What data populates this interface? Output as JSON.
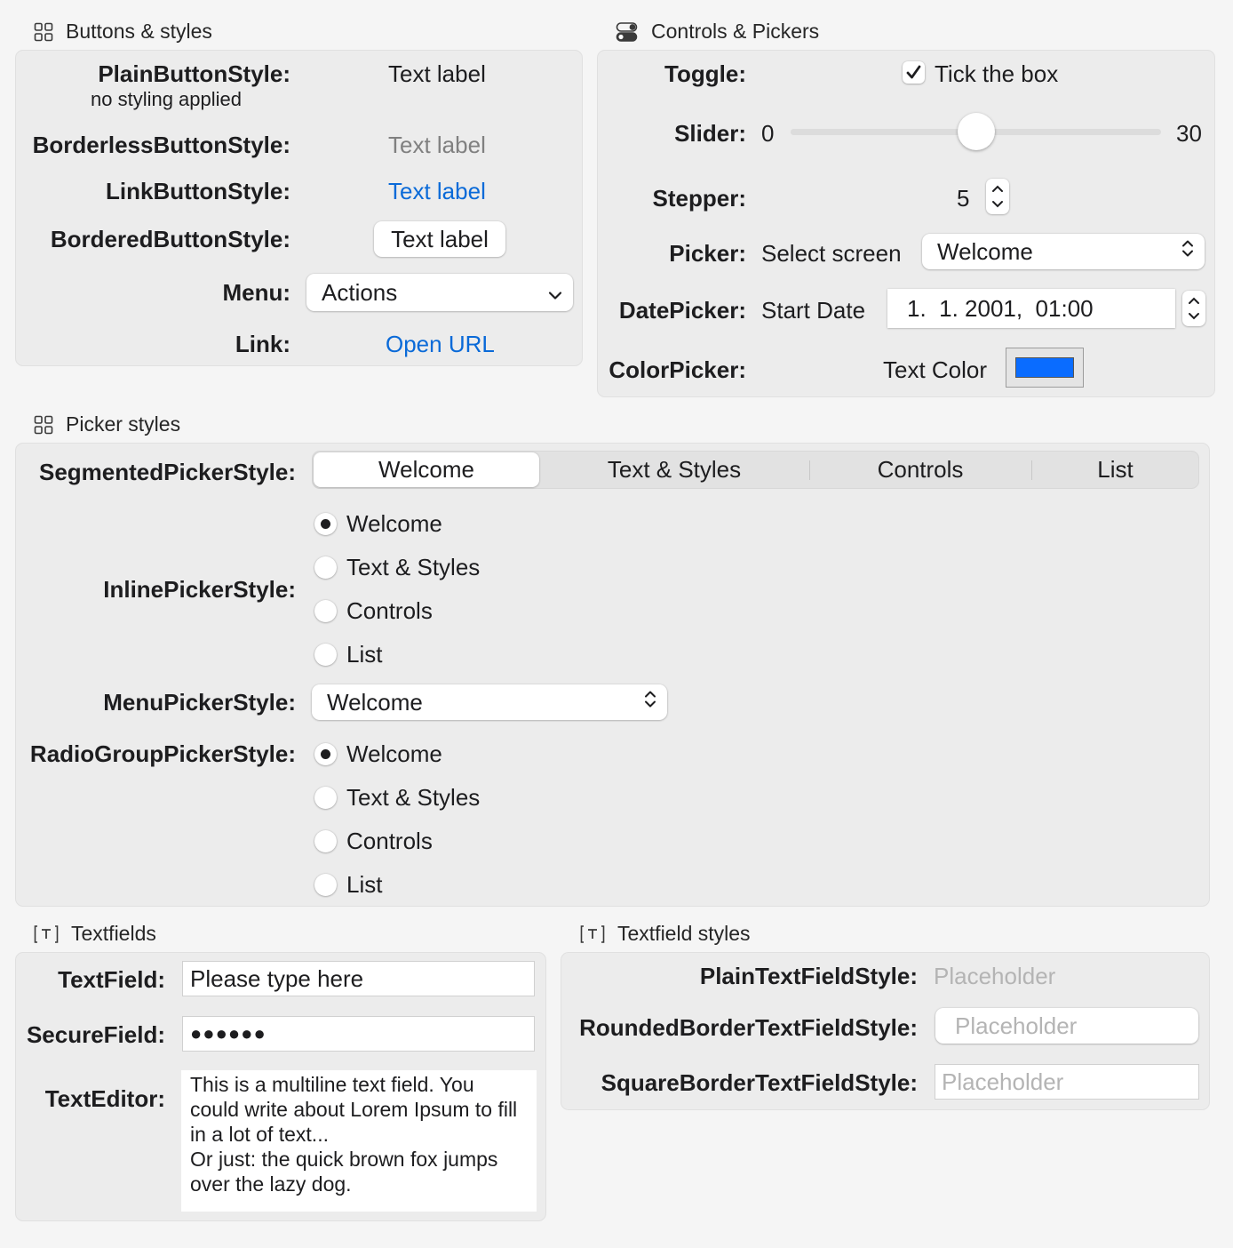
{
  "sections": {
    "buttons_title": "Buttons & styles",
    "controls_title": "Controls & Pickers",
    "pickers_title": "Picker styles",
    "textfields_title": "Textfields",
    "textfield_styles_title": "Textfield styles"
  },
  "buttons": {
    "plain_label": "PlainButtonStyle:",
    "plain_sub": "no styling applied",
    "plain_text": "Text label",
    "borderless_label": "BorderlessButtonStyle:",
    "borderless_text": "Text label",
    "link_label": "LinkButtonStyle:",
    "link_text": "Text label",
    "bordered_label": "BorderedButtonStyle:",
    "bordered_text": "Text label",
    "menu_label": "Menu:",
    "menu_value": "Actions",
    "link2_label": "Link:",
    "link2_text": "Open URL"
  },
  "controls": {
    "toggle_label": "Toggle:",
    "toggle_text": "Tick the box",
    "toggle_checked": true,
    "slider_label": "Slider:",
    "slider_min": "0",
    "slider_max": "30",
    "slider_value": 15,
    "stepper_label": "Stepper:",
    "stepper_value": "5",
    "picker_label": "Picker:",
    "picker_caption": "Select screen",
    "picker_value": "Welcome",
    "datepicker_label": "DatePicker:",
    "datepicker_caption": "Start Date",
    "datepicker_value": "1.  1. 2001,  01:00",
    "colorpicker_label": "ColorPicker:",
    "colorpicker_caption": "Text Color",
    "color_value": "#0a6cff"
  },
  "pickers": {
    "segmented_label": "SegmentedPickerStyle:",
    "inline_label": "InlinePickerStyle:",
    "menu_label": "MenuPickerStyle:",
    "radiogroup_label": "RadioGroupPickerStyle:",
    "options": [
      "Welcome",
      "Text & Styles",
      "Controls",
      "List"
    ],
    "selected_index": 0,
    "menu_value": "Welcome"
  },
  "textfields": {
    "textfield_label": "TextField:",
    "textfield_value": "Please type here",
    "securefield_label": "SecureField:",
    "securefield_value": "●●●●●●",
    "texteditor_label": "TextEditor:",
    "texteditor_value": "This is a multiline text field. You could write about Lorem Ipsum to fill in a lot of text...\nOr just: the quick brown fox jumps over the lazy dog."
  },
  "textfield_styles": {
    "plain_label": "PlainTextFieldStyle:",
    "plain_placeholder": "Placeholder",
    "rounded_label": "RoundedBorderTextFieldStyle:",
    "rounded_placeholder": "Placeholder",
    "square_label": "SquareBorderTextFieldStyle:",
    "square_placeholder": "Placeholder"
  },
  "colors": {
    "link": "#0a6ad8",
    "accent": "#0a6cff"
  }
}
